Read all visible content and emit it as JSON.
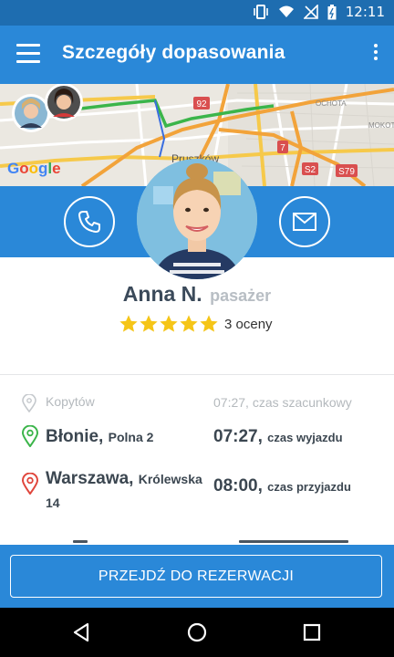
{
  "status_bar": {
    "time": "12:11"
  },
  "app_bar": {
    "title": "Szczegóły dopasowania"
  },
  "map": {
    "labels": [
      "92",
      "7",
      "S2",
      "S79",
      "Pruszków",
      "OCHOTA",
      "MOKOT"
    ],
    "provider": "Google"
  },
  "profile": {
    "name": "Anna N.",
    "role": "pasażer",
    "stars": 5,
    "rating_text": "3 oceny"
  },
  "route": {
    "via": {
      "place": "Kopytów",
      "time": "07:27, czas szacunkowy"
    },
    "from": {
      "city": "Błonie,",
      "street": "Polna 2",
      "time": "07:27,",
      "time_label": "czas wyjazdu"
    },
    "to": {
      "city": "Warszawa,",
      "street": "Królewska",
      "street2": "14",
      "time": "08:00,",
      "time_label": "czas przyjazdu"
    }
  },
  "cta": {
    "label": "PRZEJDŹ DO REZERWACJI"
  },
  "colors": {
    "primary": "#2a88d8",
    "status": "#1e6db0",
    "star": "#f5c518",
    "green_pin": "#3bb54a",
    "red_pin": "#e0463c"
  },
  "icons": [
    "menu-icon",
    "more-vert-icon",
    "phone-icon",
    "mail-icon",
    "location-pin-icon",
    "star-icon",
    "back-icon",
    "home-icon",
    "recents-icon"
  ]
}
